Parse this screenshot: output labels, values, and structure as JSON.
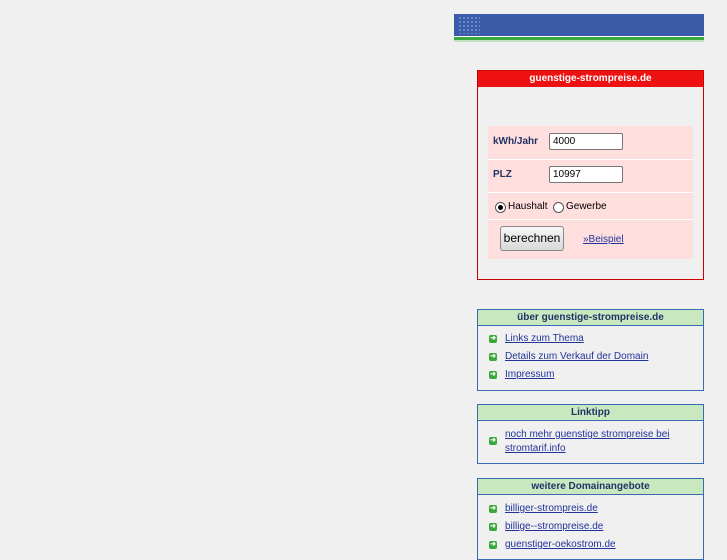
{
  "calculator": {
    "title": "guenstige-strompreise.de",
    "kwh_label": "kWh/Jahr",
    "kwh_value": "4000",
    "plz_label": "PLZ",
    "plz_value": "10997",
    "option_household": "Haushalt",
    "option_business": "Gewerbe",
    "selected_option": "Haushalt",
    "submit_label": "berechnen",
    "example_link": "»Beispiel"
  },
  "about_box": {
    "title": "über guenstige-strompreise.de",
    "items": [
      "Links zum Thema",
      "Details zum Verkauf der Domain",
      "Impressum"
    ]
  },
  "linktipp_box": {
    "title": "Linktipp",
    "items": [
      "noch mehr guenstige strompreise bei stromtarif.info"
    ]
  },
  "domains_box": {
    "title": "weitere Domainangebote",
    "items": [
      "billiger-strompreis.de",
      "billige--strompreise.de",
      "guenstiger-oekostrom.de"
    ]
  },
  "colors": {
    "header_blue": "#3a5ba8",
    "calc_red": "#ee1111",
    "box_green": "#c8e8c0",
    "link_blue": "#223399"
  }
}
